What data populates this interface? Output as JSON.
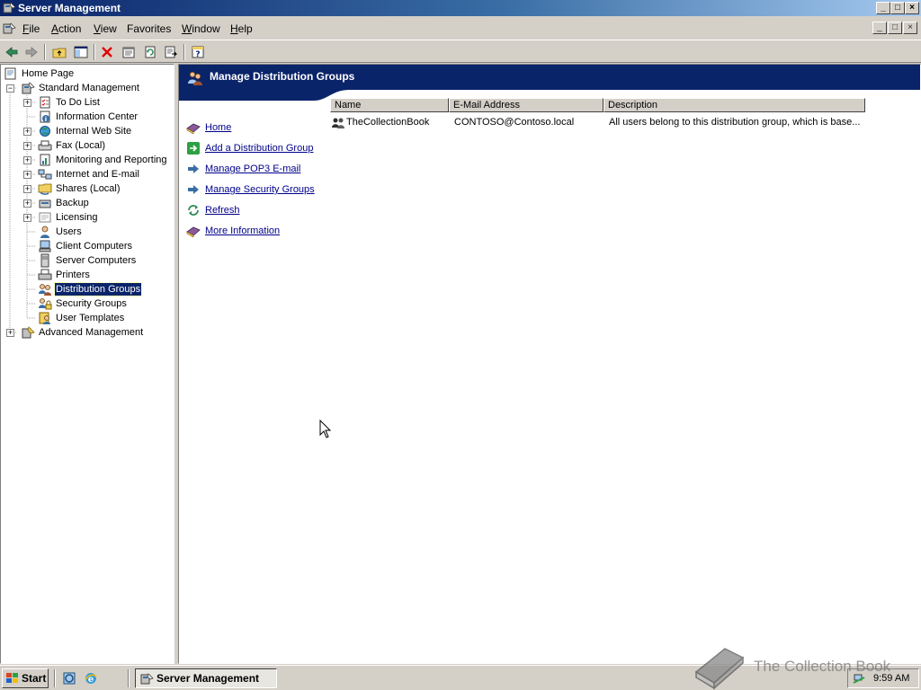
{
  "window": {
    "title": "Server Management",
    "caption_buttons": [
      "_",
      "□",
      "×"
    ]
  },
  "menu": {
    "items": [
      {
        "label": "File",
        "mnemonic": "F"
      },
      {
        "label": "Action",
        "mnemonic": "A"
      },
      {
        "label": "View",
        "mnemonic": "V"
      },
      {
        "label": "Favorites",
        "mnemonic": ""
      },
      {
        "label": "Window",
        "mnemonic": "W"
      },
      {
        "label": "Help",
        "mnemonic": "H"
      }
    ]
  },
  "toolbar": {
    "icons": [
      "back-arrow-icon",
      "forward-arrow-icon",
      "up-folder-icon",
      "show-hide-tree-icon",
      "delete-icon",
      "properties-icon",
      "refresh-icon",
      "export-list-icon",
      "help-icon"
    ]
  },
  "tree": {
    "items": [
      {
        "label": "Home Page",
        "icon": "home-page-icon",
        "selected": false
      },
      {
        "label": "Standard Management",
        "icon": "management-icon",
        "selected": false
      },
      {
        "label": "To Do List",
        "icon": "todo-icon",
        "selected": false
      },
      {
        "label": "Information Center",
        "icon": "info-icon",
        "selected": false
      },
      {
        "label": "Internal Web Site",
        "icon": "web-site-icon",
        "selected": false
      },
      {
        "label": "Fax (Local)",
        "icon": "fax-icon",
        "selected": false
      },
      {
        "label": "Monitoring and Reporting",
        "icon": "monitoring-icon",
        "selected": false
      },
      {
        "label": "Internet and E-mail",
        "icon": "network-icon",
        "selected": false
      },
      {
        "label": "Shares (Local)",
        "icon": "shares-folder-icon",
        "selected": false
      },
      {
        "label": "Backup",
        "icon": "backup-icon",
        "selected": false
      },
      {
        "label": "Licensing",
        "icon": "licensing-icon",
        "selected": false
      },
      {
        "label": "Users",
        "icon": "user-icon",
        "selected": false
      },
      {
        "label": "Client Computers",
        "icon": "computer-icon",
        "selected": false
      },
      {
        "label": "Server Computers",
        "icon": "server-icon",
        "selected": false
      },
      {
        "label": "Printers",
        "icon": "printer-icon",
        "selected": false
      },
      {
        "label": "Distribution Groups",
        "icon": "group-icon",
        "selected": true
      },
      {
        "label": "Security Groups",
        "icon": "security-group-icon",
        "selected": false
      },
      {
        "label": "User Templates",
        "icon": "user-template-icon",
        "selected": false
      },
      {
        "label": "Advanced Management",
        "icon": "advanced-management-icon",
        "selected": false
      }
    ]
  },
  "content": {
    "header_title": "Manage Distribution Groups",
    "tasks": [
      {
        "label": "Home",
        "icon": "book-icon"
      },
      {
        "label": "Add a Distribution Group",
        "icon": "green-arrow-icon"
      },
      {
        "label": "Manage POP3 E-mail",
        "icon": "blue-arrow-icon"
      },
      {
        "label": "Manage Security Groups",
        "icon": "blue-arrow-icon"
      },
      {
        "label": "Refresh",
        "icon": "refresh-icon"
      },
      {
        "label": "More Information",
        "icon": "book-icon"
      }
    ],
    "columns": [
      "Name",
      "E-Mail Address",
      "Description"
    ],
    "rows": [
      {
        "name": "TheCollectionBook",
        "email": "CONTOSO@Contoso.local",
        "description": "All users belong to this distribution group, which is base..."
      }
    ]
  },
  "taskbar": {
    "start_label": "Start",
    "quick_launch": [
      "server-manage-icon",
      "internet-explorer-icon"
    ],
    "task_button_label": "Server Management",
    "clock": "9:59 AM"
  },
  "watermark": {
    "text": "The Collection Book"
  },
  "colors": {
    "title_gradient_start": "#0a246a",
    "title_gradient_end": "#a6caf0",
    "header_band": "#0a246a",
    "link": "#00008b",
    "selection": "#0a246a",
    "face": "#d4d0c8"
  }
}
